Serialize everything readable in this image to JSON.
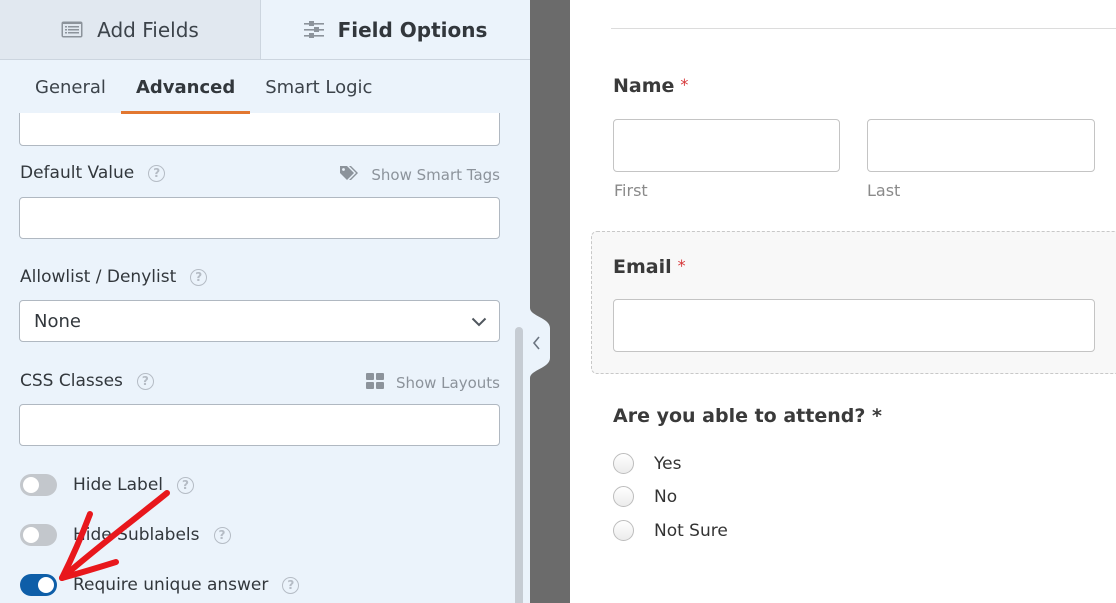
{
  "left_panel": {
    "top_tabs": [
      {
        "label": "Add Fields",
        "icon": "list-icon",
        "active": false
      },
      {
        "label": "Field Options",
        "icon": "sliders-icon",
        "active": true
      }
    ],
    "sub_tabs": [
      {
        "label": "General",
        "active": false
      },
      {
        "label": "Advanced",
        "active": true
      },
      {
        "label": "Smart Logic",
        "active": false
      }
    ],
    "default_value": {
      "label": "Default Value",
      "value": "",
      "link_label": "Show Smart Tags",
      "link_icon": "tag-icon"
    },
    "allowlist": {
      "label": "Allowlist / Denylist",
      "selected": "None"
    },
    "css_classes": {
      "label": "CSS Classes",
      "value": "",
      "link_label": "Show Layouts",
      "link_icon": "grid-icon"
    },
    "toggles": [
      {
        "label": "Hide Label",
        "on": false
      },
      {
        "label": "Hide Sublabels",
        "on": false
      },
      {
        "label": "Require unique answer",
        "on": true
      }
    ],
    "help_glyph": "?",
    "colors": {
      "accent_tab": "#e27730",
      "toggle_on": "#0e5ea8",
      "annotation_arrow": "#e8171c"
    }
  },
  "preview": {
    "name_field": {
      "label": "Name",
      "required_mark": "*",
      "sublabels": [
        "First",
        "Last"
      ]
    },
    "email_field": {
      "label": "Email",
      "required_mark": "*"
    },
    "attend_field": {
      "label": "Are you able to attend? *",
      "options": [
        "Yes",
        "No",
        "Not Sure"
      ]
    }
  }
}
